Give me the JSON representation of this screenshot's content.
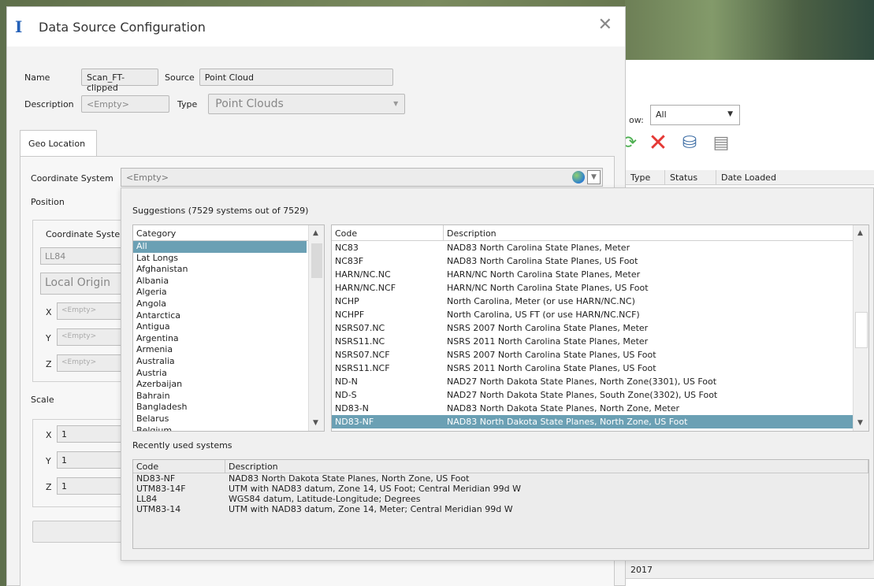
{
  "dialog": {
    "title": "Data Source Configuration",
    "name_label": "Name",
    "name_value": "Scan_FT-clipped",
    "source_label": "Source",
    "source_value": "Point Cloud",
    "description_label": "Description",
    "description_value": "<Empty>",
    "type_label": "Type",
    "type_value": "Point Clouds",
    "tab_geo_location": "Geo Location",
    "coordinate_system_label": "Coordinate System",
    "coordinate_system_value": "<Empty>",
    "position_label": "Position",
    "position_coord_label": "Coordinate Syste",
    "position_coord_value": "LL84",
    "local_origin_value": "Local Origin",
    "x_label": "X",
    "y_label": "Y",
    "z_label": "Z",
    "x_value": "<Empty>",
    "y_value": "<Empty>",
    "z_value": "<Empty>",
    "scale_label": "Scale",
    "scale_x": "1",
    "scale_y": "1",
    "scale_z": "1"
  },
  "suggestions": {
    "title": "Suggestions (7529 systems out of 7529)",
    "category_header": "Category",
    "categories": [
      "All",
      "Lat Longs",
      "Afghanistan",
      "Albania",
      "Algeria",
      "Angola",
      "Antarctica",
      "Antigua",
      "Argentina",
      "Armenia",
      "Australia",
      "Austria",
      "Azerbaijan",
      "Bahrain",
      "Bangladesh",
      "Belarus",
      "Belgium"
    ],
    "code_header": "Code",
    "description_header": "Description",
    "rows": [
      {
        "code": "NC83",
        "desc": "NAD83 North Carolina State Planes, Meter"
      },
      {
        "code": "NC83F",
        "desc": "NAD83 North Carolina State Planes, US Foot"
      },
      {
        "code": "HARN/NC.NC",
        "desc": "HARN/NC North Carolina State Planes, Meter"
      },
      {
        "code": "HARN/NC.NCF",
        "desc": "HARN/NC North Carolina State Planes, US Foot"
      },
      {
        "code": "NCHP",
        "desc": "North Carolina, Meter (or use HARN/NC.NC)"
      },
      {
        "code": "NCHPF",
        "desc": "North Carolina, US FT (or use HARN/NC.NCF)"
      },
      {
        "code": "NSRS07.NC",
        "desc": "NSRS 2007 North Carolina State Planes, Meter"
      },
      {
        "code": "NSRS11.NC",
        "desc": "NSRS 2011 North Carolina State Planes, Meter"
      },
      {
        "code": "NSRS07.NCF",
        "desc": "NSRS 2007 North Carolina State Planes, US Foot"
      },
      {
        "code": "NSRS11.NCF",
        "desc": "NSRS 2011 North Carolina State Planes, US Foot"
      },
      {
        "code": "ND-N",
        "desc": "NAD27 North Dakota State Planes, North Zone(3301), US Foot"
      },
      {
        "code": "ND-S",
        "desc": "NAD27 North Dakota State Planes, South Zone(3302), US Foot"
      },
      {
        "code": "ND83-N",
        "desc": "NAD83 North Dakota State Planes, North Zone, Meter"
      },
      {
        "code": "ND83-NF",
        "desc": "NAD83 North Dakota State Planes, North Zone, US Foot"
      }
    ],
    "recent_title": "Recently used systems",
    "recent_code_header": "Code",
    "recent_desc_header": "Description",
    "recent_rows": [
      {
        "code": "ND83-NF",
        "desc": "NAD83 North Dakota State Planes, North Zone, US Foot"
      },
      {
        "code": "UTM83-14F",
        "desc": "UTM with NAD83 datum, Zone 14, US Foot; Central Meridian 99d W"
      },
      {
        "code": "LL84",
        "desc": "WGS84 datum, Latitude-Longitude; Degrees"
      },
      {
        "code": "UTM83-14",
        "desc": "UTM with NAD83 datum, Zone 14, Meter; Central Meridian 99d W"
      }
    ]
  },
  "back_panel": {
    "show_label": "ow:",
    "show_value": "All",
    "col_type": "Type",
    "col_status": "Status",
    "col_date": "Date Loaded",
    "year_text": "2017"
  },
  "colors": {
    "selection": "#6ba0b4",
    "accent_icon": "#2461b8"
  }
}
